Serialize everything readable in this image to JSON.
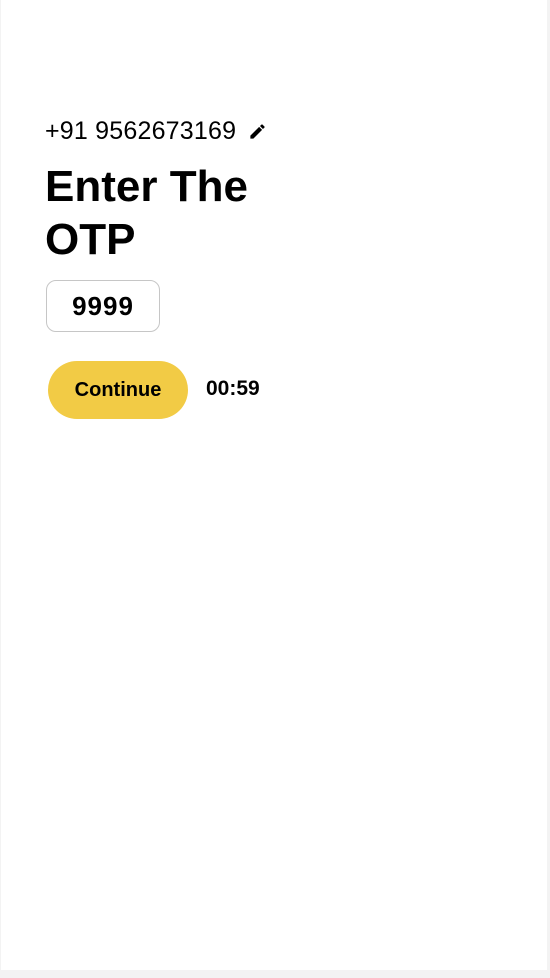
{
  "login": {
    "phone_number": "+91 9562673169",
    "edit_icon": "pencil-icon",
    "title": "Enter The OTP",
    "otp_value": "9999",
    "continue_label": "Continue",
    "timer": "00:59"
  },
  "colors": {
    "accent": "#f2cb45",
    "input_border": "#c6c6c6",
    "text": "#000000",
    "background": "#ffffff"
  }
}
